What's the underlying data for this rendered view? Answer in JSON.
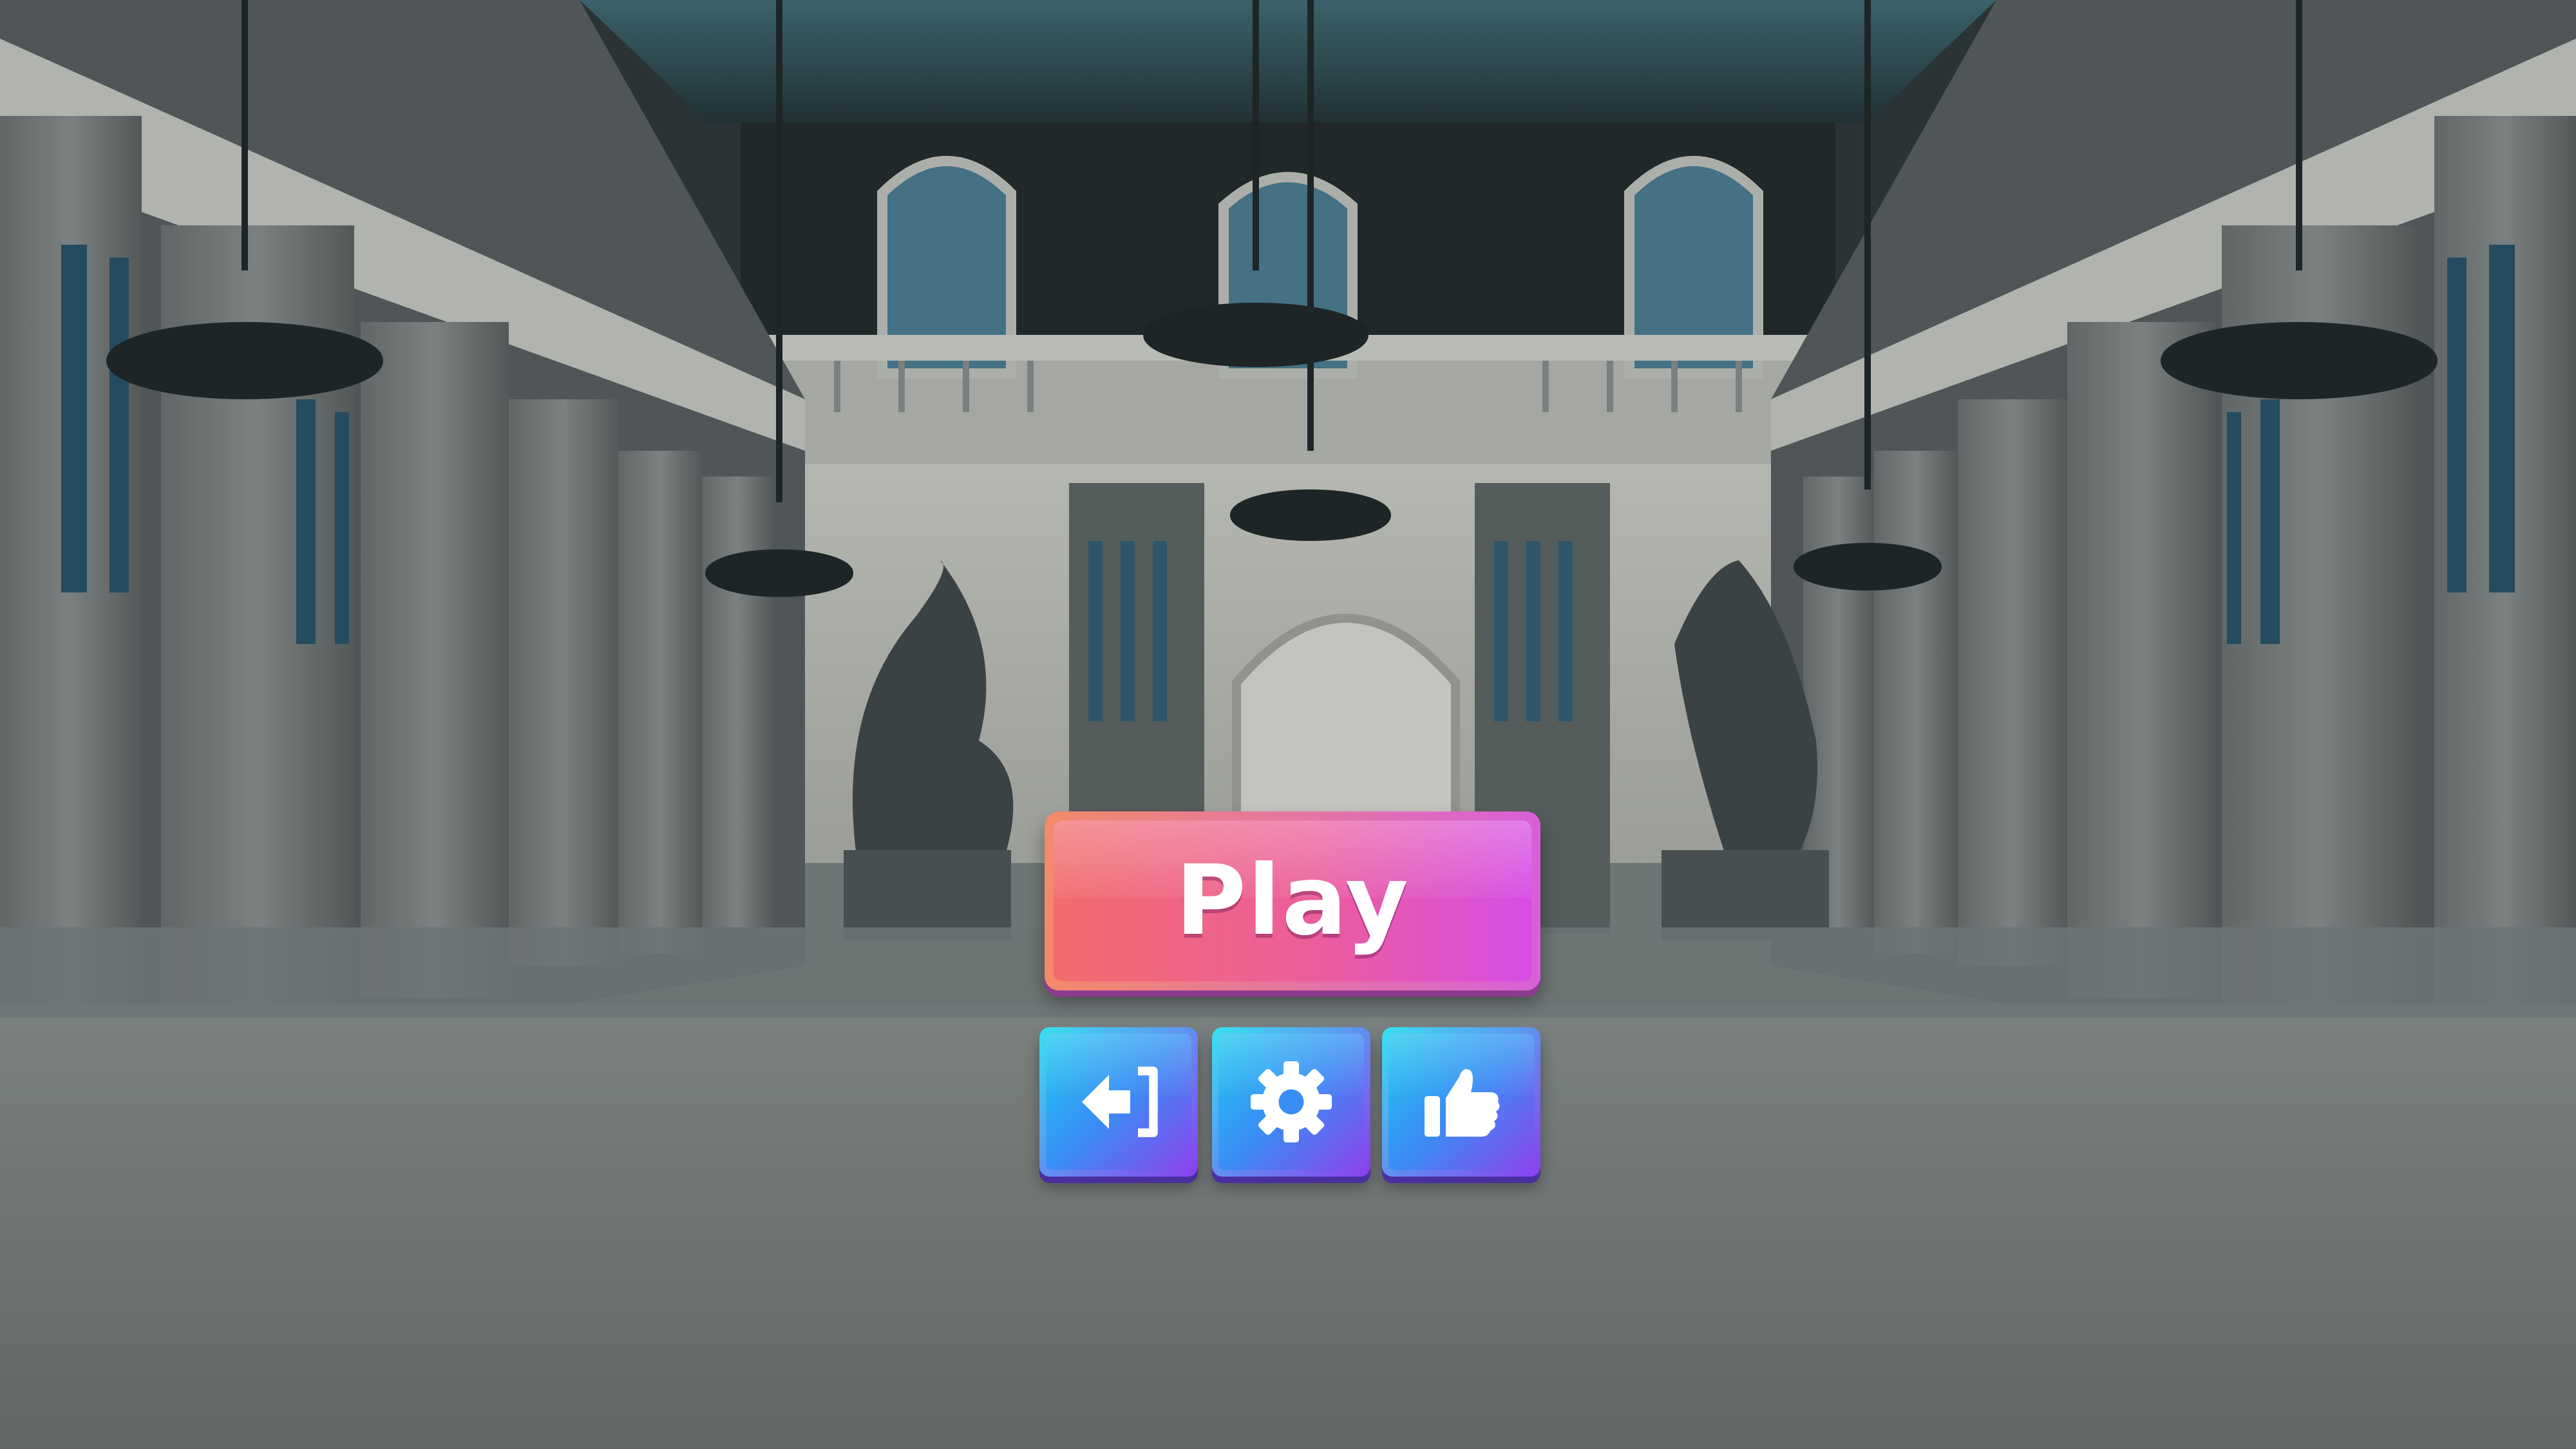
{
  "screen": "main-menu",
  "menu": {
    "play_label": "Play",
    "buttons": [
      {
        "id": "exit",
        "icon": "exit-icon"
      },
      {
        "id": "settings",
        "icon": "gear-icon"
      },
      {
        "id": "rate",
        "icon": "thumbs-up-icon"
      }
    ]
  },
  "colors": {
    "play_gradient_start": "#f26c6c",
    "play_gradient_end": "#d64ce6",
    "icon_gradient_start": "#20c9f0",
    "icon_gradient_end": "#8a45ee",
    "icon_glyph": "#ffffff",
    "floor": "#7d8583",
    "ceiling": "#3d6670"
  }
}
